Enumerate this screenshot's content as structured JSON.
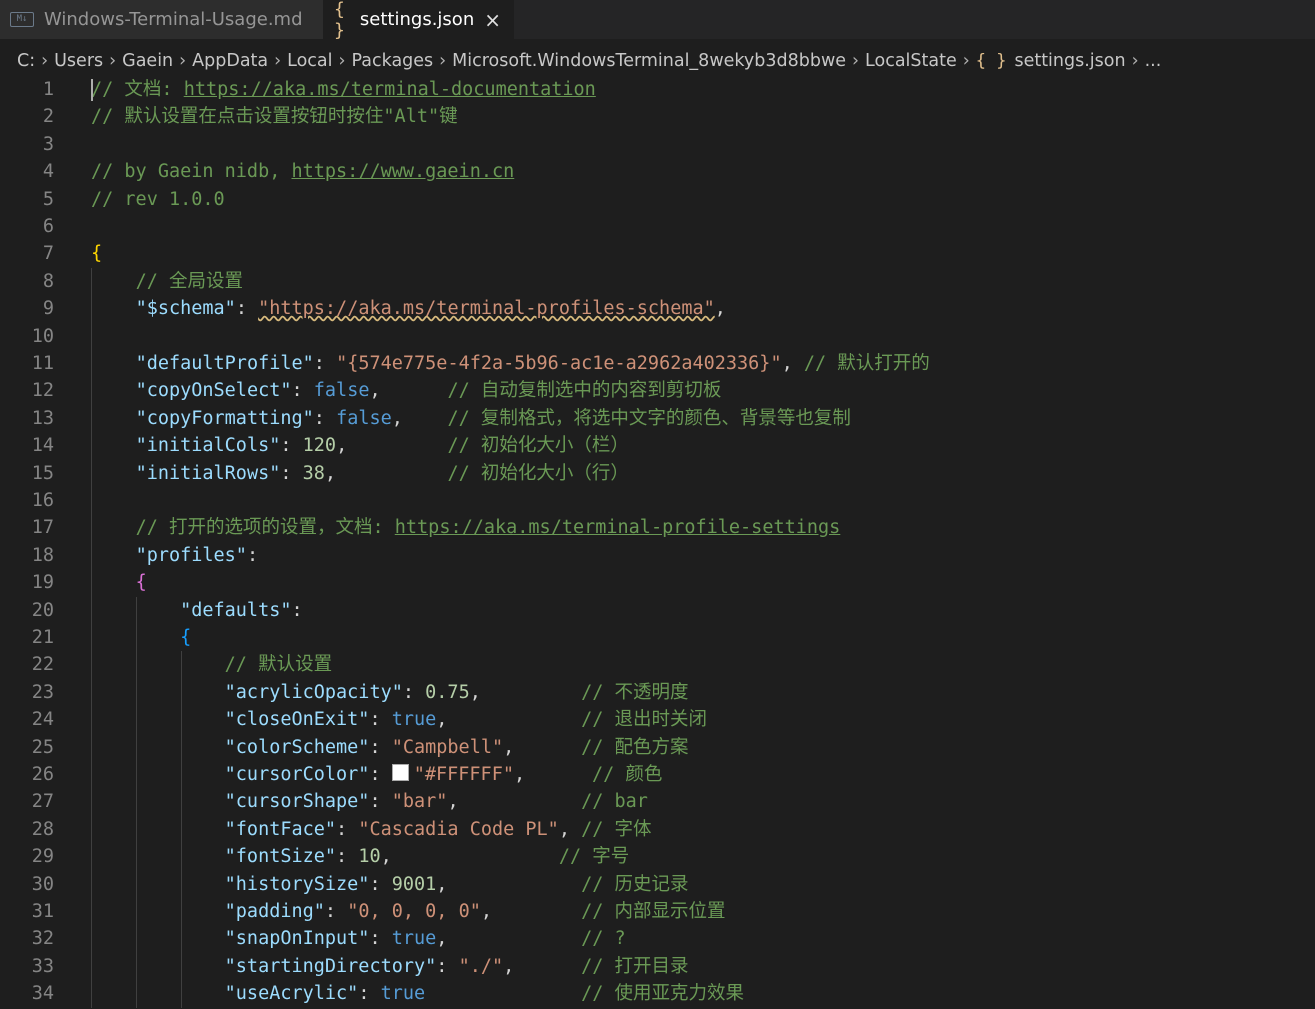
{
  "tabs": [
    {
      "icon": "markdown-icon",
      "label": "Windows-Terminal-Usage.md",
      "active": false
    },
    {
      "icon": "json-icon",
      "label": "settings.json",
      "active": true
    }
  ],
  "tab_close": "×",
  "breadcrumb": [
    "C:",
    "Users",
    "Gaein",
    "AppData",
    "Local",
    "Packages",
    "Microsoft.WindowsTerminal_8wekyb3d8bbwe",
    "LocalState",
    "settings.json",
    "..."
  ],
  "code_lines": [
    {
      "n": "1",
      "tokens": [
        [
          "cmt",
          "// 文档: "
        ],
        [
          "lnk",
          "https://aka.ms/terminal-documentation"
        ]
      ]
    },
    {
      "n": "2",
      "tokens": [
        [
          "cmt",
          "// 默认设置在点击设置按钮时按住\"Alt\"键"
        ]
      ]
    },
    {
      "n": "3",
      "tokens": []
    },
    {
      "n": "4",
      "tokens": [
        [
          "cmt",
          "// by Gaein nidb, "
        ],
        [
          "lnk",
          "https://www.gaein.cn"
        ]
      ]
    },
    {
      "n": "5",
      "tokens": [
        [
          "cmt",
          "// rev 1.0.0"
        ]
      ]
    },
    {
      "n": "6",
      "tokens": []
    },
    {
      "n": "7",
      "tokens": [
        [
          "br1",
          "{"
        ]
      ]
    },
    {
      "n": "8",
      "tokens": [
        [
          "pun",
          "    "
        ],
        [
          "cmt",
          "// 全局设置"
        ]
      ]
    },
    {
      "n": "9",
      "tokens": [
        [
          "pun",
          "    "
        ],
        [
          "key",
          "\"$schema\""
        ],
        [
          "pun",
          ": "
        ],
        [
          "str squig",
          "\"https://aka.ms/terminal-profiles-schema\""
        ],
        [
          "pun",
          ","
        ]
      ]
    },
    {
      "n": "10",
      "tokens": []
    },
    {
      "n": "11",
      "tokens": [
        [
          "pun",
          "    "
        ],
        [
          "key",
          "\"defaultProfile\""
        ],
        [
          "pun",
          ": "
        ],
        [
          "str",
          "\"{574e775e-4f2a-5b96-ac1e-a2962a402336}\""
        ],
        [
          "pun",
          ", "
        ],
        [
          "cmt",
          "// 默认打开的"
        ]
      ]
    },
    {
      "n": "12",
      "tokens": [
        [
          "pun",
          "    "
        ],
        [
          "key",
          "\"copyOnSelect\""
        ],
        [
          "pun",
          ": "
        ],
        [
          "kw",
          "false"
        ],
        [
          "pun",
          ",      "
        ],
        [
          "cmt",
          "// 自动复制选中的内容到剪切板"
        ]
      ]
    },
    {
      "n": "13",
      "tokens": [
        [
          "pun",
          "    "
        ],
        [
          "key",
          "\"copyFormatting\""
        ],
        [
          "pun",
          ": "
        ],
        [
          "kw",
          "false"
        ],
        [
          "pun",
          ",    "
        ],
        [
          "cmt",
          "// 复制格式，将选中文字的颜色、背景等也复制"
        ]
      ]
    },
    {
      "n": "14",
      "tokens": [
        [
          "pun",
          "    "
        ],
        [
          "key",
          "\"initialCols\""
        ],
        [
          "pun",
          ": "
        ],
        [
          "num",
          "120"
        ],
        [
          "pun",
          ",         "
        ],
        [
          "cmt",
          "// 初始化大小（栏）"
        ]
      ]
    },
    {
      "n": "15",
      "tokens": [
        [
          "pun",
          "    "
        ],
        [
          "key",
          "\"initialRows\""
        ],
        [
          "pun",
          ": "
        ],
        [
          "num",
          "38"
        ],
        [
          "pun",
          ",          "
        ],
        [
          "cmt",
          "// 初始化大小（行）"
        ]
      ]
    },
    {
      "n": "16",
      "tokens": []
    },
    {
      "n": "17",
      "tokens": [
        [
          "pun",
          "    "
        ],
        [
          "cmt",
          "// 打开的选项的设置，文档: "
        ],
        [
          "lnk",
          "https://aka.ms/terminal-profile-settings"
        ]
      ]
    },
    {
      "n": "18",
      "tokens": [
        [
          "pun",
          "    "
        ],
        [
          "key",
          "\"profiles\""
        ],
        [
          "pun",
          ":"
        ]
      ]
    },
    {
      "n": "19",
      "tokens": [
        [
          "pun",
          "    "
        ],
        [
          "br2",
          "{"
        ]
      ]
    },
    {
      "n": "20",
      "tokens": [
        [
          "pun",
          "        "
        ],
        [
          "key",
          "\"defaults\""
        ],
        [
          "pun",
          ":"
        ]
      ]
    },
    {
      "n": "21",
      "tokens": [
        [
          "pun",
          "        "
        ],
        [
          "br3",
          "{"
        ]
      ]
    },
    {
      "n": "22",
      "tokens": [
        [
          "pun",
          "            "
        ],
        [
          "cmt",
          "// 默认设置"
        ]
      ]
    },
    {
      "n": "23",
      "tokens": [
        [
          "pun",
          "            "
        ],
        [
          "key",
          "\"acrylicOpacity\""
        ],
        [
          "pun",
          ": "
        ],
        [
          "num",
          "0.75"
        ],
        [
          "pun",
          ",         "
        ],
        [
          "cmt",
          "// 不透明度"
        ]
      ]
    },
    {
      "n": "24",
      "tokens": [
        [
          "pun",
          "            "
        ],
        [
          "key",
          "\"closeOnExit\""
        ],
        [
          "pun",
          ": "
        ],
        [
          "kw",
          "true"
        ],
        [
          "pun",
          ",            "
        ],
        [
          "cmt",
          "// 退出时关闭"
        ]
      ]
    },
    {
      "n": "25",
      "tokens": [
        [
          "pun",
          "            "
        ],
        [
          "key",
          "\"colorScheme\""
        ],
        [
          "pun",
          ": "
        ],
        [
          "str",
          "\"Campbell\""
        ],
        [
          "pun",
          ",      "
        ],
        [
          "cmt",
          "// 配色方案"
        ]
      ]
    },
    {
      "n": "26",
      "tokens": [
        [
          "pun",
          "            "
        ],
        [
          "key",
          "\"cursorColor\""
        ],
        [
          "pun",
          ": "
        ],
        [
          "swatch",
          ""
        ],
        [
          "str",
          "\"#FFFFFF\""
        ],
        [
          "pun",
          ",      "
        ],
        [
          "cmt",
          "// 颜色"
        ]
      ]
    },
    {
      "n": "27",
      "tokens": [
        [
          "pun",
          "            "
        ],
        [
          "key",
          "\"cursorShape\""
        ],
        [
          "pun",
          ": "
        ],
        [
          "str",
          "\"bar\""
        ],
        [
          "pun",
          ",           "
        ],
        [
          "cmt",
          "// bar"
        ]
      ]
    },
    {
      "n": "28",
      "tokens": [
        [
          "pun",
          "            "
        ],
        [
          "key",
          "\"fontFace\""
        ],
        [
          "pun",
          ": "
        ],
        [
          "str",
          "\"Cascadia Code PL\""
        ],
        [
          "pun",
          ", "
        ],
        [
          "cmt",
          "// 字体"
        ]
      ]
    },
    {
      "n": "29",
      "tokens": [
        [
          "pun",
          "            "
        ],
        [
          "key",
          "\"fontSize\""
        ],
        [
          "pun",
          ": "
        ],
        [
          "num",
          "10"
        ],
        [
          "pun",
          ",               "
        ],
        [
          "cmt",
          "// 字号"
        ]
      ]
    },
    {
      "n": "30",
      "tokens": [
        [
          "pun",
          "            "
        ],
        [
          "key",
          "\"historySize\""
        ],
        [
          "pun",
          ": "
        ],
        [
          "num",
          "9001"
        ],
        [
          "pun",
          ",            "
        ],
        [
          "cmt",
          "// 历史记录"
        ]
      ]
    },
    {
      "n": "31",
      "tokens": [
        [
          "pun",
          "            "
        ],
        [
          "key",
          "\"padding\""
        ],
        [
          "pun",
          ": "
        ],
        [
          "str",
          "\"0, 0, 0, 0\""
        ],
        [
          "pun",
          ",        "
        ],
        [
          "cmt",
          "// 内部显示位置"
        ]
      ]
    },
    {
      "n": "32",
      "tokens": [
        [
          "pun",
          "            "
        ],
        [
          "key",
          "\"snapOnInput\""
        ],
        [
          "pun",
          ": "
        ],
        [
          "kw",
          "true"
        ],
        [
          "pun",
          ",            "
        ],
        [
          "cmt",
          "// ?"
        ]
      ]
    },
    {
      "n": "33",
      "tokens": [
        [
          "pun",
          "            "
        ],
        [
          "key",
          "\"startingDirectory\""
        ],
        [
          "pun",
          ": "
        ],
        [
          "str",
          "\"./\""
        ],
        [
          "pun",
          ",      "
        ],
        [
          "cmt",
          "// 打开目录"
        ]
      ]
    },
    {
      "n": "34",
      "tokens": [
        [
          "pun",
          "            "
        ],
        [
          "key",
          "\"useAcrylic\""
        ],
        [
          "pun",
          ": "
        ],
        [
          "kw",
          "true"
        ],
        [
          "pun",
          "              "
        ],
        [
          "cmt",
          "// 使用亚克力效果"
        ]
      ]
    }
  ]
}
